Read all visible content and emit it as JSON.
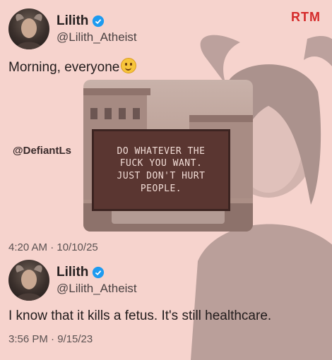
{
  "brand": {
    "logo": "RTM"
  },
  "tweets": [
    {
      "name": "Lilith",
      "handle": "@Lilith_Atheist",
      "text": "Morning, everyone",
      "emoji": "smiling-face-emoji",
      "time": "4:20 AM · 10/10/25",
      "image": {
        "watermark": "@DefiantLs",
        "sign_text": "DO WHATEVER THE\nFUCK YOU WANT.\nJUST DON'T HURT\nPEOPLE."
      }
    },
    {
      "name": "Lilith",
      "handle": "@Lilith_Atheist",
      "text": "I know that it kills a fetus. It's still healthcare.",
      "time": "3:56 PM · 9/15/23"
    }
  ],
  "colors": {
    "background": "#f6d3cd",
    "verified": "#1d9bf0",
    "logo": "#d52a2a"
  }
}
